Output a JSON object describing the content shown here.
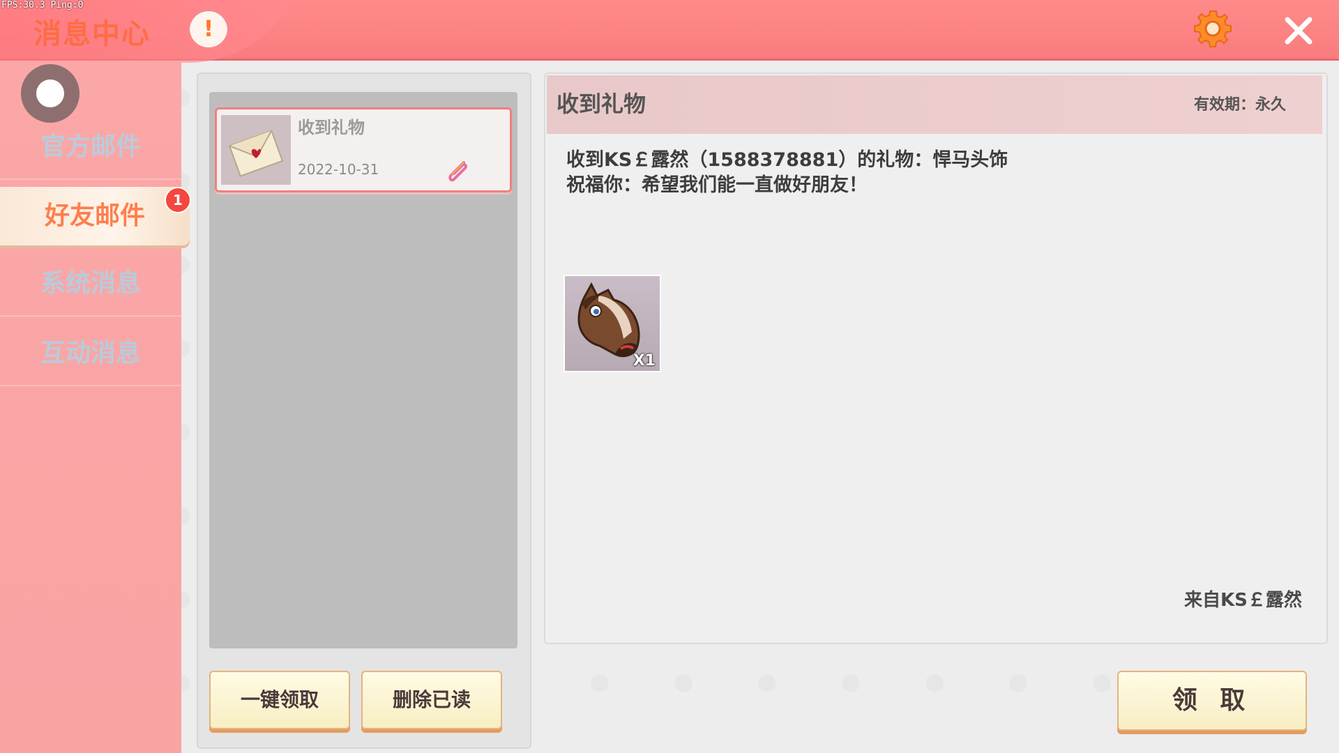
{
  "debug": {
    "fps_text": "FPS:30.3 Ping:0"
  },
  "header": {
    "title": "消息中心",
    "info_label": "!"
  },
  "sidebar": {
    "items": [
      {
        "label": "官方邮件"
      },
      {
        "label": "好友邮件"
      },
      {
        "label": "系统消息"
      },
      {
        "label": "互动消息"
      }
    ],
    "active_index": 1,
    "friend_mail_badge": "1"
  },
  "mail_list": {
    "items": [
      {
        "title": "收到礼物",
        "date": "2022-10-31"
      }
    ]
  },
  "actions": {
    "claim_all": "一键领取",
    "delete_read": "删除已读",
    "claim": "领 取"
  },
  "detail": {
    "title": "收到礼物",
    "validity": "有效期：永久",
    "line1": "收到KS￡露然（1588378881）的礼物：悍马头饰",
    "line2": "祝福你：希望我们能一直做好朋友！",
    "gift": {
      "icon": "horse-head-icon",
      "count": "X1"
    },
    "sender": "来自KS￡露然"
  },
  "colors": {
    "topbar": "#f97c7e",
    "sidebar": "#fba7a7",
    "accent": "#ff7e4e",
    "badge": "#f3473f"
  }
}
